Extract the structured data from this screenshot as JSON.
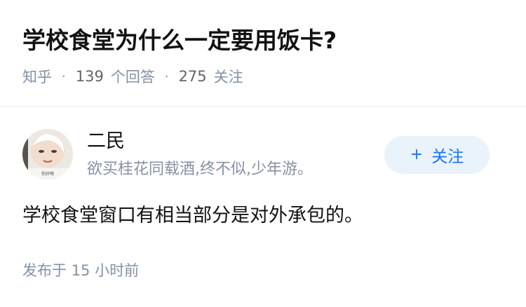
{
  "question": {
    "title": "学校食堂为什么一定要用饭卡?",
    "source": "知乎",
    "separator": "·",
    "answer_count": "139",
    "answer_label": "个回答",
    "follower_count": "275",
    "follower_label": "关注"
  },
  "answer": {
    "author": {
      "name": "二民",
      "bio": "欲买桂花同载酒,终不似,少年游。",
      "avatar_icon": "avatar-photo",
      "avatar_caption": "你好啊"
    },
    "follow_button": {
      "icon": "+",
      "label": "关注"
    },
    "content": "学校食堂窗口有相当部分是对外承包的。",
    "published_prefix": "发布于",
    "published_time": "15 小时前"
  },
  "colors": {
    "title": "#121212",
    "meta": "#8590a6",
    "accent": "#1772f6",
    "follow_bg": "#eaf2fc",
    "divider": "#ebebeb"
  }
}
